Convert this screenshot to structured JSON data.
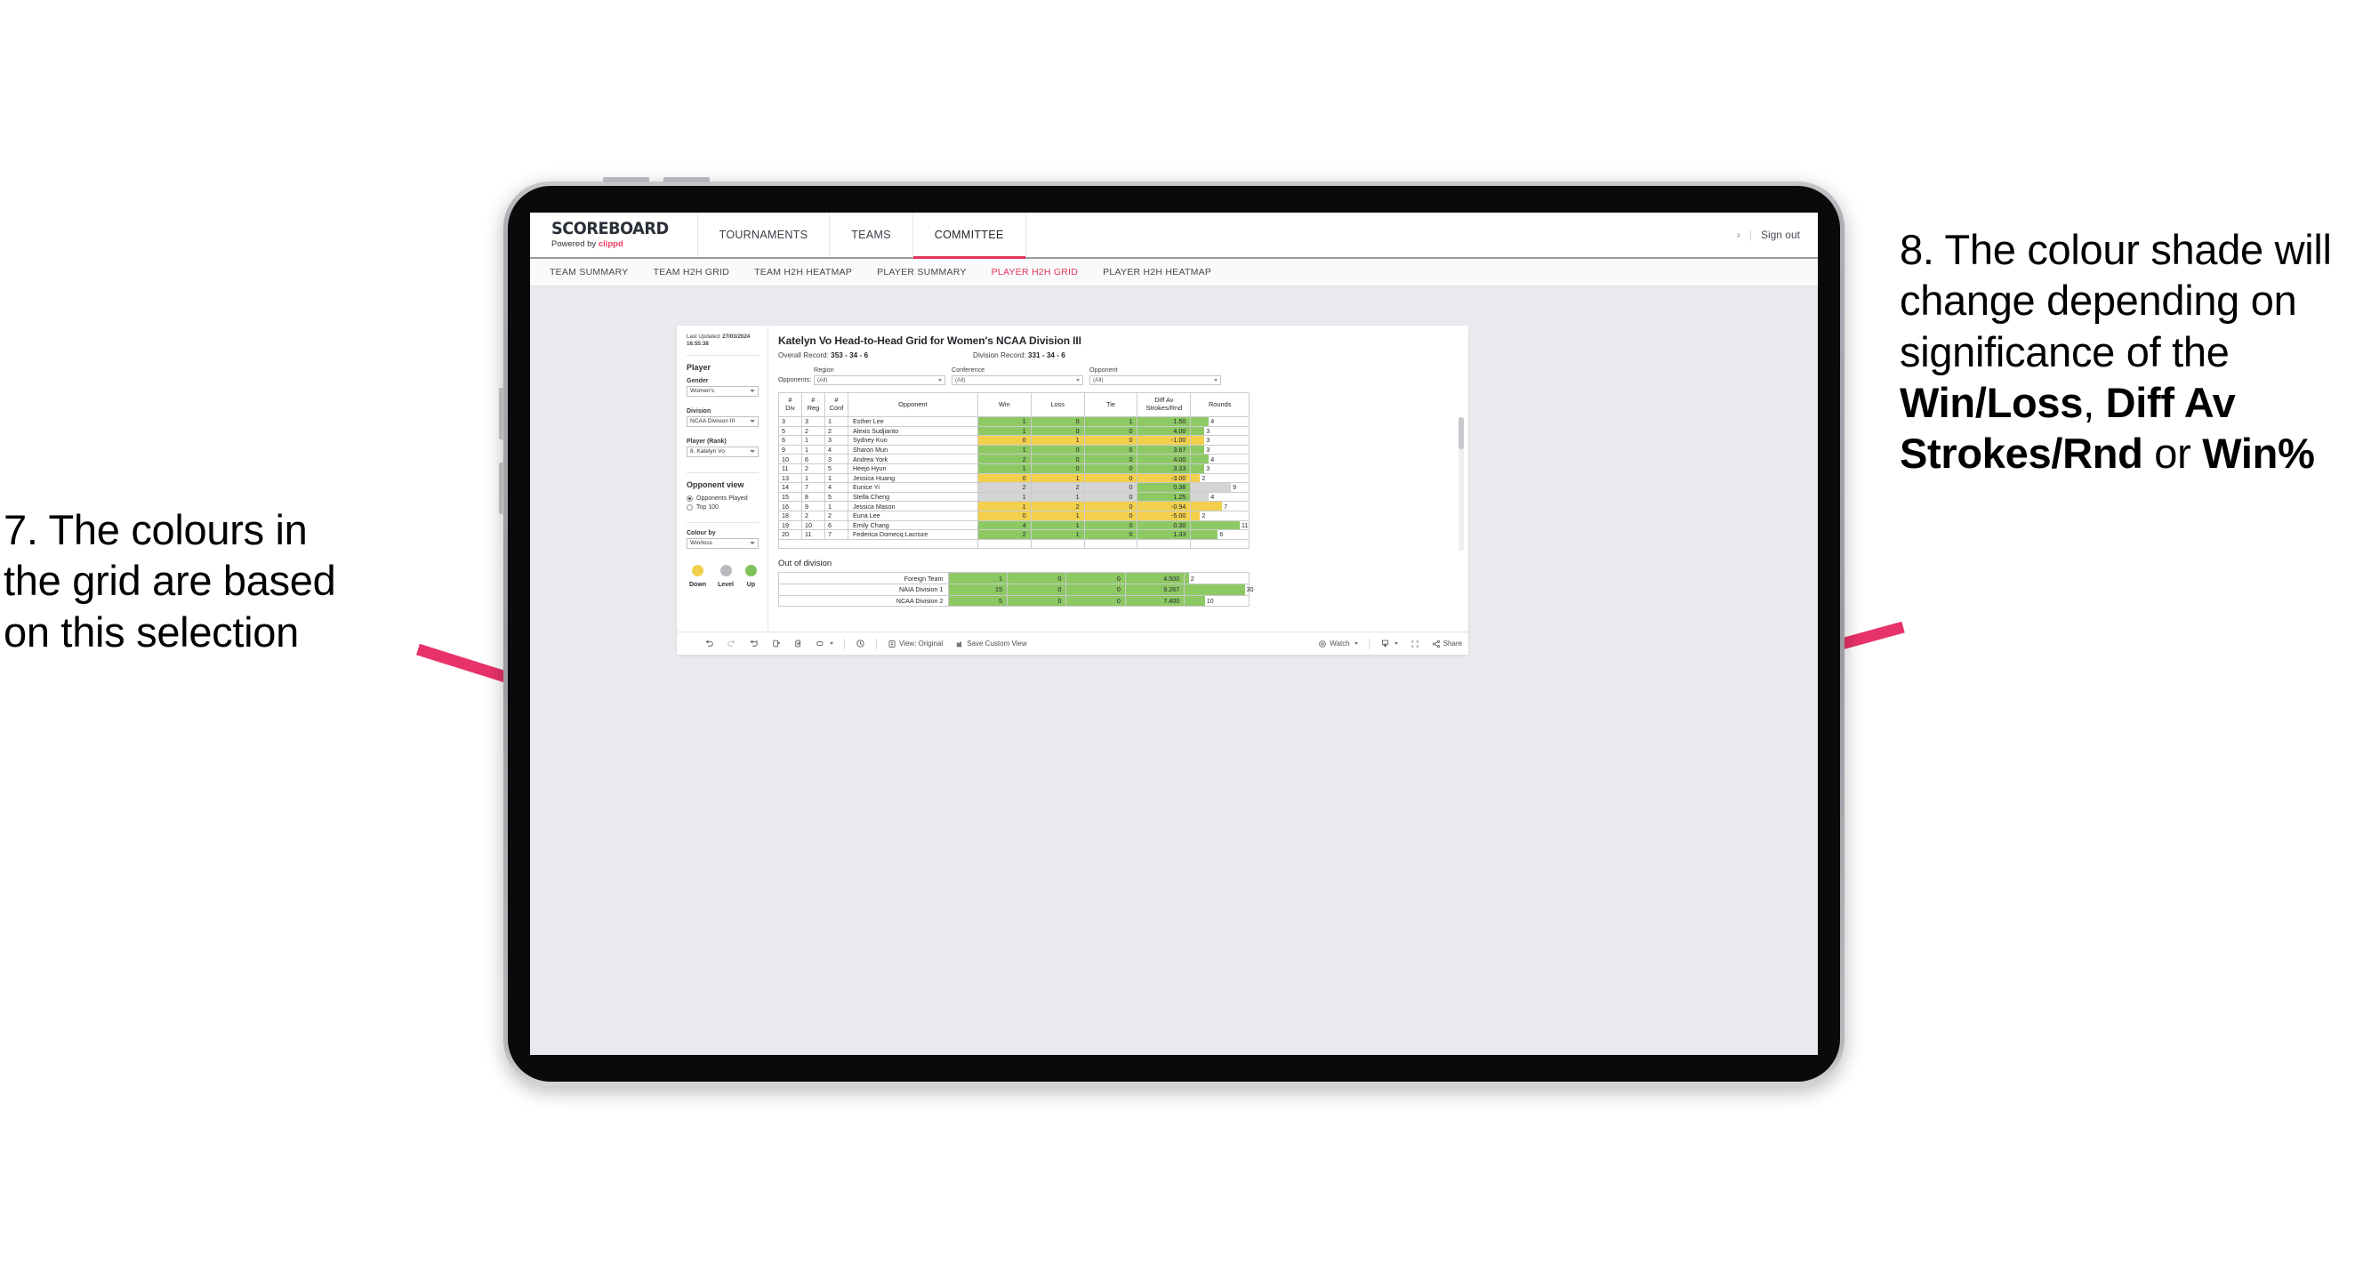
{
  "annotations": {
    "left": {
      "lines": [
        "7. The colours in",
        "the grid are based",
        "on this selection"
      ]
    },
    "right": {
      "pre": "8. The colour shade will change depending on significance of the ",
      "bold1": "Win/Loss",
      "mid1": ", ",
      "bold2": "Diff Av Strokes/Rnd",
      "mid2": " or ",
      "bold3": "Win%"
    },
    "arrow_color": "#e8326a"
  },
  "header": {
    "brand_name": "SCOREBOARD",
    "brand_powered_prefix": "Powered by ",
    "brand_powered_name": "clippd",
    "nav": [
      {
        "label": "TOURNAMENTS",
        "active": false
      },
      {
        "label": "TEAMS",
        "active": false
      },
      {
        "label": "COMMITTEE",
        "active": true
      }
    ],
    "chevron": "›",
    "divider": "|",
    "signout": "Sign out"
  },
  "subnav": {
    "items": [
      {
        "label": "TEAM SUMMARY",
        "active": false
      },
      {
        "label": "TEAM H2H GRID",
        "active": false
      },
      {
        "label": "TEAM H2H HEATMAP",
        "active": false
      },
      {
        "label": "PLAYER SUMMARY",
        "active": false
      },
      {
        "label": "PLAYER H2H GRID",
        "active": true
      },
      {
        "label": "PLAYER H2H HEATMAP",
        "active": false
      }
    ]
  },
  "sidebar": {
    "last_updated_label": "Last Updated: ",
    "last_updated_date": "27/03/2024",
    "last_updated_time": "16:55:38",
    "player_section_title": "Player",
    "gender_label": "Gender",
    "gender_value": "Women's",
    "division_label": "Division",
    "division_value": "NCAA Division III",
    "player_rank_label": "Player (Rank)",
    "player_rank_value": "8. Katelyn Vo",
    "opponent_view_title": "Opponent view",
    "opponent_view_options": [
      {
        "label": "Opponents Played",
        "selected": true
      },
      {
        "label": "Top 100",
        "selected": false
      }
    ],
    "colour_by_label": "Colour by",
    "colour_by_value": "Win/loss",
    "legend": [
      {
        "label": "Down",
        "color": "#f2cf4a"
      },
      {
        "label": "Level",
        "color": "#b8babd"
      },
      {
        "label": "Up",
        "color": "#7ec35a"
      }
    ]
  },
  "viz": {
    "title": "Katelyn Vo Head-to-Head Grid for Women's NCAA Division III",
    "overall_record_label": "Overall Record: ",
    "overall_record_value": "353 -  34 - 6",
    "division_record_label": "Division Record: ",
    "division_record_value": "331 -  34 - 6",
    "opponents_label": "Opponents:",
    "opp_filters": [
      {
        "caption": "Region",
        "value": "(All)"
      },
      {
        "caption": "Conference",
        "value": "(All)"
      },
      {
        "caption": "Opponent",
        "value": "(All)"
      }
    ],
    "out_of_division_title": "Out of division"
  },
  "chart_data": {
    "type": "table",
    "title": "Katelyn Vo Head-to-Head Grid for Women's NCAA Division III",
    "columns": [
      "# Div",
      "# Reg",
      "# Conf",
      "Opponent",
      "Win",
      "Loss",
      "Tie",
      "Diff Av Strokes/Rnd",
      "Rounds"
    ],
    "column_headers_multiline": [
      [
        "#",
        "Div"
      ],
      [
        "#",
        "Reg"
      ],
      [
        "#",
        "Conf"
      ],
      [
        "Opponent"
      ],
      [
        "Win"
      ],
      [
        "Loss"
      ],
      [
        "Tie"
      ],
      [
        "Diff Av",
        "Strokes/Rnd"
      ],
      [
        "Rounds"
      ]
    ],
    "colors": {
      "up": "#8dc963",
      "down": "#f2d04e",
      "level": "#d4d4d4",
      "accent": "#e3355a"
    },
    "rounds_max": 13,
    "rows": [
      {
        "div": "3",
        "reg": "3",
        "conf": "1",
        "opponent": "Esther Lee",
        "win": "1",
        "loss": "0",
        "tie": "1",
        "diff": "1.50",
        "rounds": 4,
        "state": "up"
      },
      {
        "div": "5",
        "reg": "2",
        "conf": "2",
        "opponent": "Alexis Sudjianto",
        "win": "1",
        "loss": "0",
        "tie": "0",
        "diff": "4.00",
        "rounds": 3,
        "state": "up"
      },
      {
        "div": "6",
        "reg": "1",
        "conf": "3",
        "opponent": "Sydney Kuo",
        "win": "0",
        "loss": "1",
        "tie": "0",
        "diff": "-1.00",
        "rounds": 3,
        "state": "down"
      },
      {
        "div": "9",
        "reg": "1",
        "conf": "4",
        "opponent": "Sharon Mun",
        "win": "1",
        "loss": "0",
        "tie": "0",
        "diff": "3.67",
        "rounds": 3,
        "state": "up"
      },
      {
        "div": "10",
        "reg": "6",
        "conf": "3",
        "opponent": "Andrea York",
        "win": "2",
        "loss": "0",
        "tie": "0",
        "diff": "4.00",
        "rounds": 4,
        "state": "up"
      },
      {
        "div": "11",
        "reg": "2",
        "conf": "5",
        "opponent": "Heejo Hyun",
        "win": "1",
        "loss": "0",
        "tie": "0",
        "diff": "3.33",
        "rounds": 3,
        "state": "up"
      },
      {
        "div": "13",
        "reg": "1",
        "conf": "1",
        "opponent": "Jessica Huang",
        "win": "0",
        "loss": "1",
        "tie": "0",
        "diff": "-3.00",
        "rounds": 2,
        "state": "down"
      },
      {
        "div": "14",
        "reg": "7",
        "conf": "4",
        "opponent": "Eunice Yi",
        "win": "2",
        "loss": "2",
        "tie": "0",
        "diff": "0.38",
        "rounds": 9,
        "state": "level",
        "diff_state": "up"
      },
      {
        "div": "15",
        "reg": "8",
        "conf": "5",
        "opponent": "Stella Cheng",
        "win": "1",
        "loss": "1",
        "tie": "0",
        "diff": "1.25",
        "rounds": 4,
        "state": "level",
        "diff_state": "up"
      },
      {
        "div": "16",
        "reg": "9",
        "conf": "1",
        "opponent": "Jessica Mason",
        "win": "1",
        "loss": "2",
        "tie": "0",
        "diff": "-0.94",
        "rounds": 7,
        "state": "down"
      },
      {
        "div": "18",
        "reg": "2",
        "conf": "2",
        "opponent": "Euna Lee",
        "win": "0",
        "loss": "1",
        "tie": "0",
        "diff": "-5.00",
        "rounds": 2,
        "state": "down"
      },
      {
        "div": "19",
        "reg": "10",
        "conf": "6",
        "opponent": "Emily Chang",
        "win": "4",
        "loss": "1",
        "tie": "0",
        "diff": "0.30",
        "rounds": 11,
        "state": "up"
      },
      {
        "div": "20",
        "reg": "11",
        "conf": "7",
        "opponent": "Federica Domecq Lacroze",
        "win": "2",
        "loss": "1",
        "tie": "0",
        "diff": "1.33",
        "rounds": 6,
        "state": "up"
      }
    ],
    "out_of_division": {
      "rounds_max": 32,
      "rows": [
        {
          "name": "Foreign Team",
          "win": "1",
          "loss": "0",
          "tie": "0",
          "diff": "4.500",
          "rounds": 2,
          "state": "up"
        },
        {
          "name": "NAIA Division 1",
          "win": "15",
          "loss": "0",
          "tie": "0",
          "diff": "9.267",
          "rounds": 30,
          "state": "up"
        },
        {
          "name": "NCAA Division 2",
          "win": "5",
          "loss": "0",
          "tie": "0",
          "diff": "7.400",
          "rounds": 10,
          "state": "up"
        }
      ]
    }
  },
  "toolbar": {
    "view_label": "View: Original",
    "save_label": "Save Custom View",
    "watch_label": "Watch",
    "share_label": "Share"
  }
}
